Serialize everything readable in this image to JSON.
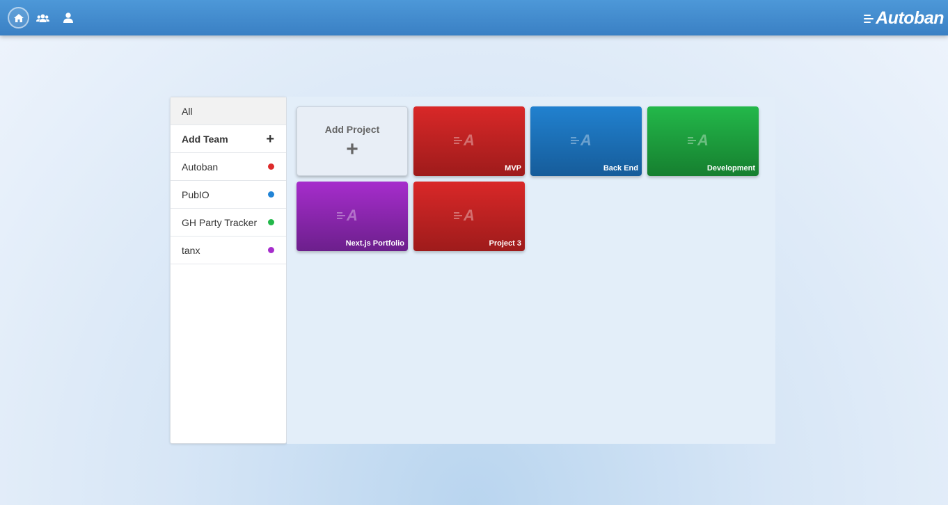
{
  "nav": {
    "brand": "Autoban",
    "icons": [
      "home-icon",
      "teams-icon",
      "user-icon"
    ]
  },
  "sidebar": {
    "all_label": "All",
    "add_team_label": "Add Team",
    "add_team_icon": "+",
    "teams": [
      {
        "label": "Autoban",
        "color": "#dd2b2b"
      },
      {
        "label": "PubIO",
        "color": "#2284d6"
      },
      {
        "label": "GH Party Tracker",
        "color": "#23b84a"
      },
      {
        "label": "tanx",
        "color": "#a62dcc"
      }
    ]
  },
  "projects": {
    "add_label": "Add Project",
    "add_icon": "+",
    "card_logo_letter": "A",
    "items": [
      {
        "title": "MVP",
        "color": "red"
      },
      {
        "title": "Back End",
        "color": "blue"
      },
      {
        "title": "Development",
        "color": "green"
      },
      {
        "title": "Next.js Portfolio",
        "color": "purple"
      },
      {
        "title": "Project 3",
        "color": "red"
      }
    ]
  }
}
